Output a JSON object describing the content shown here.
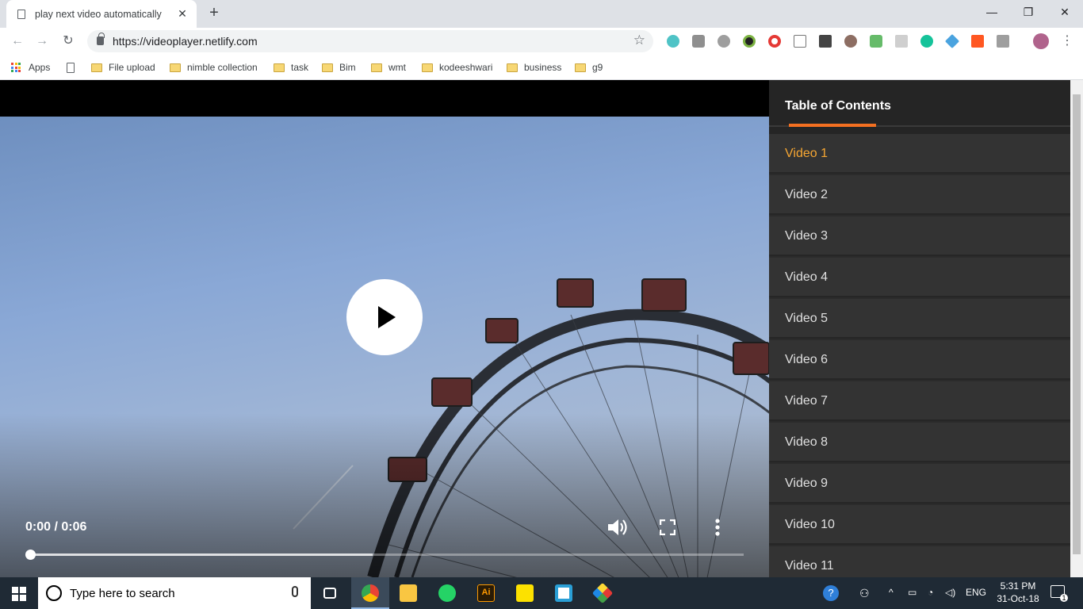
{
  "browser": {
    "tab_title": "play next video automatically",
    "tab_close": "✕",
    "new_tab": "+",
    "window_controls": {
      "minimize": "—",
      "maximize": "❐",
      "close": "✕"
    },
    "url": "https://videoplayer.netlify.com",
    "bookmark_star": "☆",
    "extension_icons": [
      "cube-extension-icon",
      "camera-extension-icon",
      "chat-extension-icon",
      "color-extension-icon",
      "opera-extension-icon",
      "text-extension-icon",
      "brush-extension-icon",
      "cookie-extension-icon",
      "check-extension-icon",
      "filter-extension-icon",
      "grammarly-icon",
      "diamond-extension-icon",
      "yandex-extension-icon",
      "translate-extension-icon",
      "profile-avatar"
    ]
  },
  "bookmarks": [
    {
      "label": "Apps",
      "icon": "apps-grid-icon"
    },
    {
      "label": "",
      "icon": "page-icon"
    },
    {
      "label": "File upload",
      "icon": "folder-icon"
    },
    {
      "label": "nimble collection",
      "icon": "folder-icon"
    },
    {
      "label": "task",
      "icon": "folder-icon"
    },
    {
      "label": "Bim",
      "icon": "folder-icon"
    },
    {
      "label": "wmt",
      "icon": "folder-icon"
    },
    {
      "label": "kodeeshwari",
      "icon": "folder-icon"
    },
    {
      "label": "business",
      "icon": "folder-icon"
    },
    {
      "label": "g9",
      "icon": "folder-icon"
    }
  ],
  "player": {
    "time": "0:00 / 0:06",
    "progress_fraction": 0.0,
    "buffered_fraction": 0.48,
    "state": "paused"
  },
  "toc": {
    "title": "Table of Contents",
    "items": [
      "Video 1",
      "Video 2",
      "Video 3",
      "Video 4",
      "Video 5",
      "Video 6",
      "Video 7",
      "Video 8",
      "Video 9",
      "Video 10",
      "Video 11"
    ],
    "active_index": 0
  },
  "colors": {
    "accent_orange": "#f37021",
    "active_item": "#f7a733",
    "sidebar_bg": "#333333"
  },
  "taskbar": {
    "search_placeholder": "Type here to search",
    "apps": [
      "task-view-icon",
      "chrome-icon",
      "file-explorer-icon",
      "whatsapp-icon",
      "illustrator-icon",
      "sticky-notes-icon",
      "app-icon",
      "git-icon"
    ],
    "language": "ENG",
    "time": "5:31 PM",
    "date": "31-Oct-18",
    "notification_count": "1"
  }
}
